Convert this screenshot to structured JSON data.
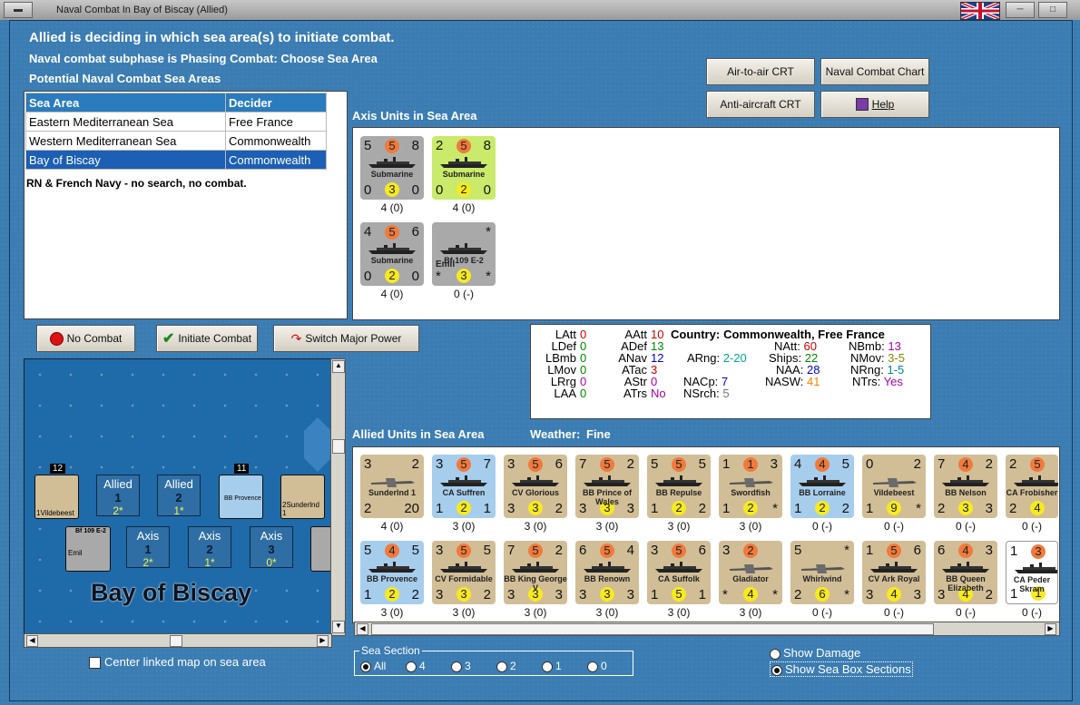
{
  "window": {
    "title": "Naval Combat In Bay of Biscay (Allied)"
  },
  "header": {
    "line1": "Allied is deciding in which sea area(s) to initiate combat.",
    "line2": "Naval combat subphase is Phasing Combat: Choose Sea Area",
    "line3": "Potential Naval Combat Sea Areas"
  },
  "buttons": {
    "air_to_air": "Air-to-air CRT",
    "naval_chart": "Naval Combat Chart",
    "anti_aircraft": "Anti-aircraft CRT",
    "help": "Help",
    "no_combat": "No Combat",
    "initiate": "Initiate Combat",
    "switch": "Switch Major Power"
  },
  "sea_table": {
    "headers": [
      "Sea Area",
      "Decider"
    ],
    "rows": [
      [
        "Eastern Mediterranean Sea",
        "Free France"
      ],
      [
        "Western Mediterranean Sea",
        "Commonwealth"
      ],
      [
        "Bay of Biscay",
        "Commonwealth"
      ]
    ],
    "note": "RN & French Navy - no search, no combat."
  },
  "axis_panel": {
    "title": "Axis Units in Sea Area"
  },
  "axis_units": [
    {
      "type": "Submarine",
      "color": "grey",
      "tl": "5",
      "tm": "5",
      "tr": "8",
      "bl": "0",
      "bm": "3",
      "br": "0",
      "stat": "4 (0)"
    },
    {
      "type": "Submarine",
      "color": "lime",
      "tl": "2",
      "tm": "5",
      "tr": "8",
      "bl": "0",
      "bm": "2",
      "br": "0",
      "stat": "4 (0)"
    },
    {
      "type": "Submarine",
      "color": "grey",
      "tl": "4",
      "tm": "5",
      "tr": "6",
      "bl": "0",
      "bm": "2",
      "br": "0",
      "stat": "4 (0)"
    },
    {
      "type": "Bf 109 E-2",
      "sub": "Emil",
      "color": "grey",
      "tl": "",
      "tm": "",
      "tr": "*",
      "bl": "*",
      "bm": "3",
      "br": "*",
      "stat": "0 (-)"
    }
  ],
  "stats": {
    "country_label": "Country:",
    "country": "Commonwealth, Free France",
    "LAtt": "0",
    "LDef": "0",
    "LBmb": "0",
    "LMov": "0",
    "LRrg": "0",
    "LAA": "0",
    "AAtt": "10",
    "ADef": "13",
    "ANav": "12",
    "ATac": "3",
    "AStr": "0",
    "ATrs": "No",
    "ARng": "2-20",
    "NACp": "7",
    "NSrch": "5",
    "NAtt": "60",
    "Ships": "22",
    "NAA": "28",
    "NASW": "41",
    "NBmb": "13",
    "NMov": "3-5",
    "NRng": "1-5",
    "NTrs": "Yes"
  },
  "allied_panel": {
    "title": "Allied Units in Sea Area",
    "weather_label": "Weather:",
    "weather": "Fine"
  },
  "allied_row1": [
    {
      "name": "Sunderlnd 1",
      "color": "tan",
      "tl": "3",
      "tr": "2",
      "bl": "2",
      "bm": "",
      "br": "20",
      "stat": "4 (0)",
      "kind": "air"
    },
    {
      "name": "CA Suffren",
      "color": "blue",
      "tl": "3",
      "tm": "5",
      "tr": "7",
      "bl": "1",
      "bm": "2",
      "br": "1",
      "stat": "3 (0)"
    },
    {
      "name": "CV Glorious",
      "color": "tan",
      "tl": "3",
      "tm": "5",
      "tr": "6",
      "bl": "3",
      "bm": "3",
      "br": "2",
      "stat": "3 (0)"
    },
    {
      "name": "BB Prince of Wales",
      "color": "tan",
      "tl": "7",
      "tm": "5",
      "tr": "2",
      "bl": "3",
      "bm": "3",
      "br": "3",
      "stat": "3 (0)"
    },
    {
      "name": "BB Repulse",
      "color": "tan",
      "tl": "5",
      "tm": "5",
      "tr": "5",
      "bl": "1",
      "bm": "2",
      "br": "2",
      "stat": "3 (0)"
    },
    {
      "name": "Swordfish",
      "color": "tan",
      "tl": "1",
      "tm": "1",
      "tr": "3",
      "bl": "1",
      "bm": "2",
      "br": "*",
      "stat": "3 (0)",
      "kind": "air"
    },
    {
      "name": "BB Lorraine",
      "color": "blue",
      "tl": "4",
      "tm": "4",
      "tr": "5",
      "bl": "1",
      "bm": "2",
      "br": "2",
      "stat": "0 (-)"
    },
    {
      "name": "Vildebeest",
      "color": "tan",
      "tl": "0",
      "tm": "",
      "tr": "2",
      "bl": "1",
      "bm": "9",
      "br": "*",
      "stat": "0 (-)",
      "kind": "air"
    },
    {
      "name": "BB Nelson",
      "color": "tan",
      "tl": "7",
      "tm": "4",
      "tr": "2",
      "bl": "2",
      "bm": "3",
      "br": "3",
      "stat": "0 (-)"
    },
    {
      "name": "CA Frobisher",
      "color": "tan",
      "tl": "2",
      "tm": "5",
      "tr": "",
      "bl": "2",
      "bm": "4",
      "br": "",
      "stat": "0 (-)"
    }
  ],
  "allied_row2": [
    {
      "name": "BB Provence",
      "color": "blue",
      "tl": "5",
      "tm": "4",
      "tr": "5",
      "bl": "1",
      "bm": "2",
      "br": "2",
      "stat": "3 (0)"
    },
    {
      "name": "CV Formidable",
      "color": "tan",
      "tl": "3",
      "tm": "5",
      "tr": "5",
      "bl": "3",
      "bm": "3",
      "br": "2",
      "stat": "3 (0)"
    },
    {
      "name": "BB King George V",
      "color": "tan",
      "tl": "7",
      "tm": "5",
      "tr": "2",
      "bl": "3",
      "bm": "3",
      "br": "3",
      "stat": "3 (0)"
    },
    {
      "name": "BB Renown",
      "color": "tan",
      "tl": "6",
      "tm": "5",
      "tr": "4",
      "bl": "3",
      "bm": "3",
      "br": "3",
      "stat": "3 (0)"
    },
    {
      "name": "CA Suffolk",
      "color": "tan",
      "tl": "3",
      "tm": "5",
      "tr": "6",
      "bl": "1",
      "bm": "5",
      "br": "1",
      "stat": "3 (0)"
    },
    {
      "name": "Gladiator",
      "color": "tan",
      "tl": "3",
      "tm": "2",
      "tr": "",
      "bl": "*",
      "bm": "4",
      "br": "*",
      "stat": "3 (0)",
      "kind": "air"
    },
    {
      "name": "Whirlwind",
      "color": "tan",
      "tl": "5",
      "tm": "",
      "tr": "*",
      "bl": "2",
      "bm": "6",
      "br": "*",
      "stat": "0 (-)",
      "kind": "air"
    },
    {
      "name": "CV Ark Royal",
      "color": "tan",
      "tl": "1",
      "tm": "5",
      "tr": "6",
      "bl": "3",
      "bm": "4",
      "br": "3",
      "stat": "0 (-)"
    },
    {
      "name": "BB Queen Elizabeth",
      "color": "tan",
      "tl": "6",
      "tm": "4",
      "tr": "3",
      "bl": "3",
      "bm": "4",
      "br": "2",
      "stat": "0 (-)"
    },
    {
      "name": "CA Peder Skram",
      "color": "white",
      "tl": "1",
      "tm": "3",
      "tr": "",
      "bl": "1",
      "bm": "1",
      "br": "",
      "stat": "0 (-)"
    }
  ],
  "map": {
    "title": "Bay of Biscay",
    "allied_boxes": [
      {
        "a": "Allied",
        "b": "1",
        "c": "2*"
      },
      {
        "a": "Allied",
        "b": "2",
        "c": "1*"
      }
    ],
    "axis_boxes": [
      {
        "a": "Axis",
        "b": "1",
        "c": "2*"
      },
      {
        "a": "Axis",
        "b": "2",
        "c": "1*"
      },
      {
        "a": "Axis",
        "b": "3",
        "c": "0*"
      }
    ],
    "labels": {
      "stack1": "12",
      "stack2": "11",
      "vild": "1Vildebeest",
      "prov": "BB Provence",
      "sund": "2Sunderlnd 1",
      "emil": "Emil",
      "bf": "Bf 109 E-2"
    }
  },
  "center_map": {
    "label": "Center linked map on sea area"
  },
  "sea_section": {
    "label": "Sea Section",
    "options": [
      "All",
      "4",
      "3",
      "2",
      "1",
      "0"
    ]
  },
  "show": {
    "damage": "Show Damage",
    "boxes": "Show Sea Box Sections"
  }
}
